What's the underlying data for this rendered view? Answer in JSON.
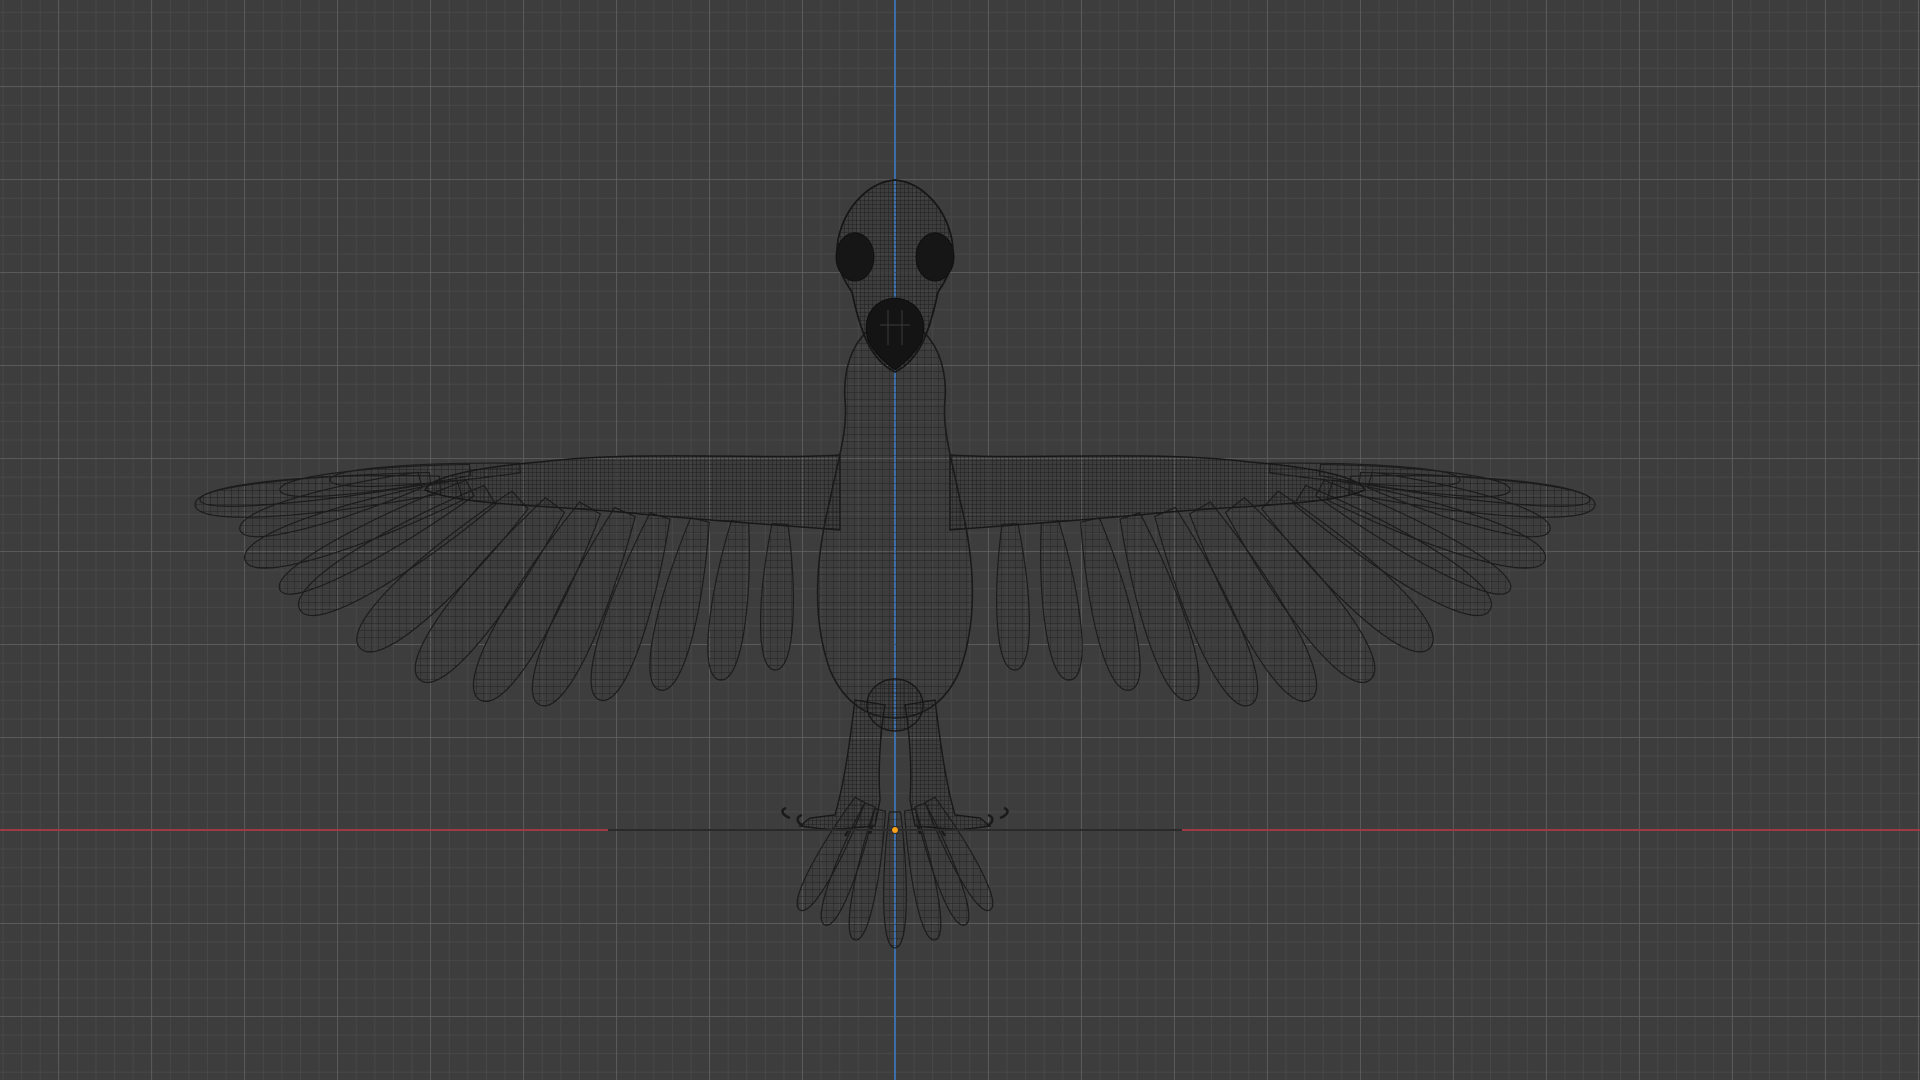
{
  "viewport": {
    "mode": "wireframe",
    "view": "front-orthographic",
    "object": "bird-mesh"
  },
  "colors": {
    "background": "#3d3d3d",
    "grid_major": "#696969",
    "grid_minor": "#505050",
    "x_axis": "#9e3a44",
    "z_axis": "#3e6ea8",
    "wire": "#1c1c1c",
    "origin": "#ffa21a"
  },
  "icons": [
    "origin-point"
  ]
}
